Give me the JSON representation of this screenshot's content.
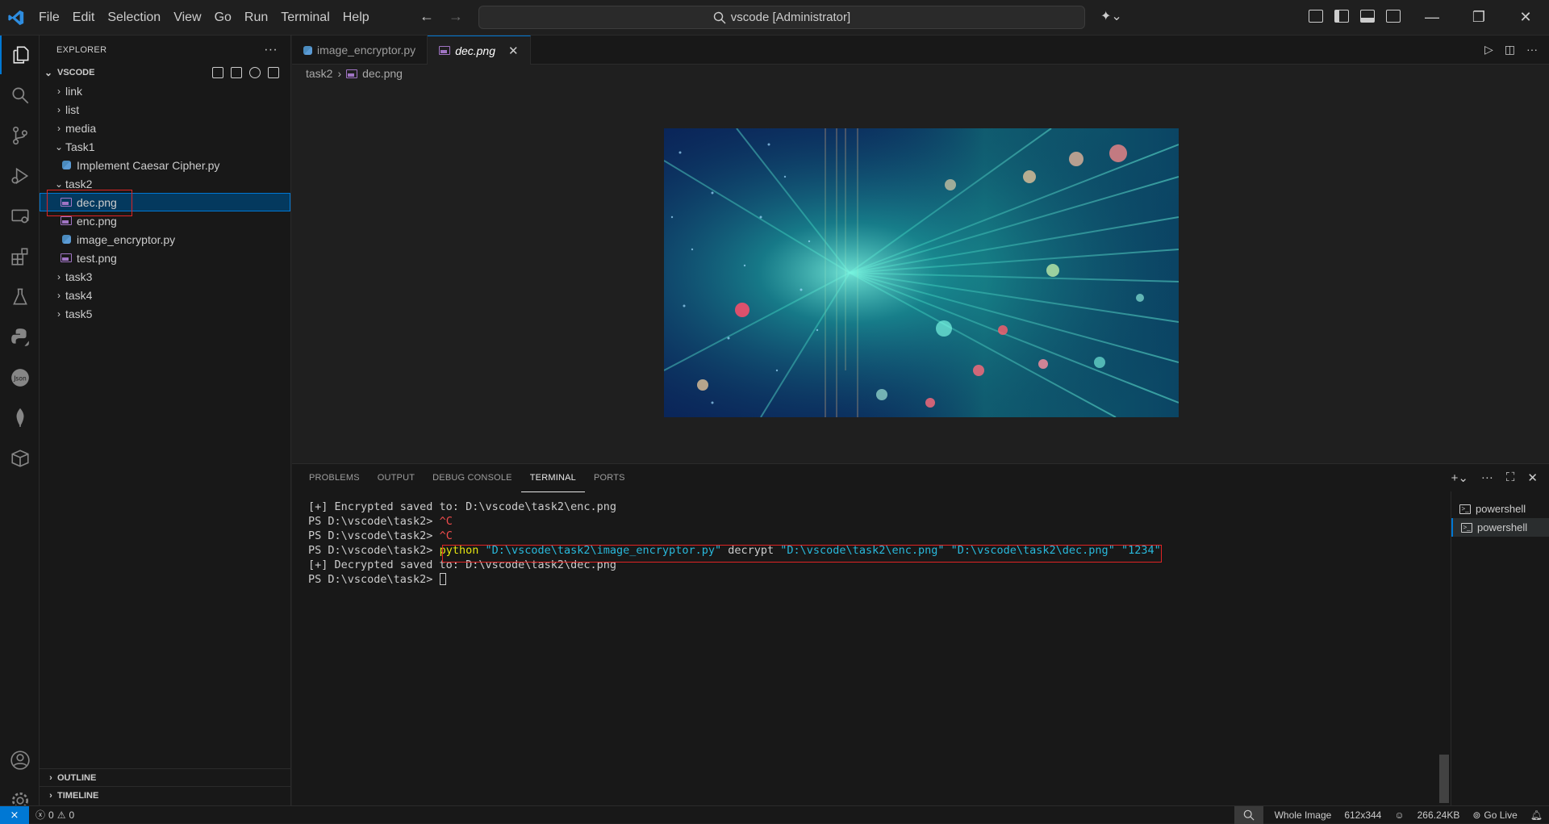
{
  "window": {
    "menu": [
      "File",
      "Edit",
      "Selection",
      "View",
      "Go",
      "Run",
      "Terminal",
      "Help"
    ],
    "search_text": "vscode [Administrator]",
    "controls": [
      "—",
      "❐",
      "✕"
    ]
  },
  "accent_color": "#0078d4",
  "sidebar": {
    "title": "EXPLORER",
    "root": "VSCODE",
    "items": [
      {
        "label": "link",
        "type": "folder",
        "depth": 0,
        "expanded": false
      },
      {
        "label": "list",
        "type": "folder",
        "depth": 0,
        "expanded": false
      },
      {
        "label": "media",
        "type": "folder",
        "depth": 0,
        "expanded": false
      },
      {
        "label": "Task1",
        "type": "folder",
        "depth": 0,
        "expanded": true
      },
      {
        "label": "Implement Caesar Cipher.py",
        "type": "python",
        "depth": 1
      },
      {
        "label": "task2",
        "type": "folder",
        "depth": 0,
        "expanded": true
      },
      {
        "label": "dec.png",
        "type": "image",
        "depth": 1,
        "selected": true
      },
      {
        "label": "enc.png",
        "type": "image",
        "depth": 1
      },
      {
        "label": "image_encryptor.py",
        "type": "python",
        "depth": 1
      },
      {
        "label": "test.png",
        "type": "image",
        "depth": 1
      },
      {
        "label": "task3",
        "type": "folder",
        "depth": 0,
        "expanded": false
      },
      {
        "label": "task4",
        "type": "folder",
        "depth": 0,
        "expanded": false
      },
      {
        "label": "task5",
        "type": "folder",
        "depth": 0,
        "expanded": false
      }
    ],
    "outline_label": "OUTLINE",
    "timeline_label": "TIMELINE"
  },
  "editor": {
    "tabs": [
      {
        "label": "image_encryptor.py",
        "icon": "python-icon",
        "active": false
      },
      {
        "label": "dec.png",
        "icon": "image-icon",
        "active": true
      }
    ],
    "breadcrumb": [
      "task2",
      "dec.png"
    ]
  },
  "panel": {
    "tabs": [
      "PROBLEMS",
      "OUTPUT",
      "DEBUG CONSOLE",
      "TERMINAL",
      "PORTS"
    ],
    "active_tab": "TERMINAL",
    "terminal_lines": {
      "l1": "[+] Encrypted saved to: D:\\vscode\\task2\\enc.png",
      "prompt": "PS D:\\vscode\\task2> ",
      "ctrl_c": "^C",
      "cmd_python": "python",
      "cmd_arg1": "\"D:\\vscode\\task2\\image_encryptor.py\"",
      "cmd_decrypt": "decrypt",
      "cmd_arg2": "\"D:\\vscode\\task2\\enc.png\"",
      "cmd_arg3": "\"D:\\vscode\\task2\\dec.png\"",
      "cmd_arg4": "\"1234\"",
      "l5": "[+] Decrypted saved to: D:\\vscode\\task2\\dec.png"
    },
    "terminals": [
      "powershell",
      "powershell"
    ]
  },
  "statusbar": {
    "errors": "0",
    "warnings": "0",
    "zoom_label": "Whole Image",
    "dimensions": "612x344",
    "file_size": "266.24KB",
    "go_live": "Go Live"
  }
}
